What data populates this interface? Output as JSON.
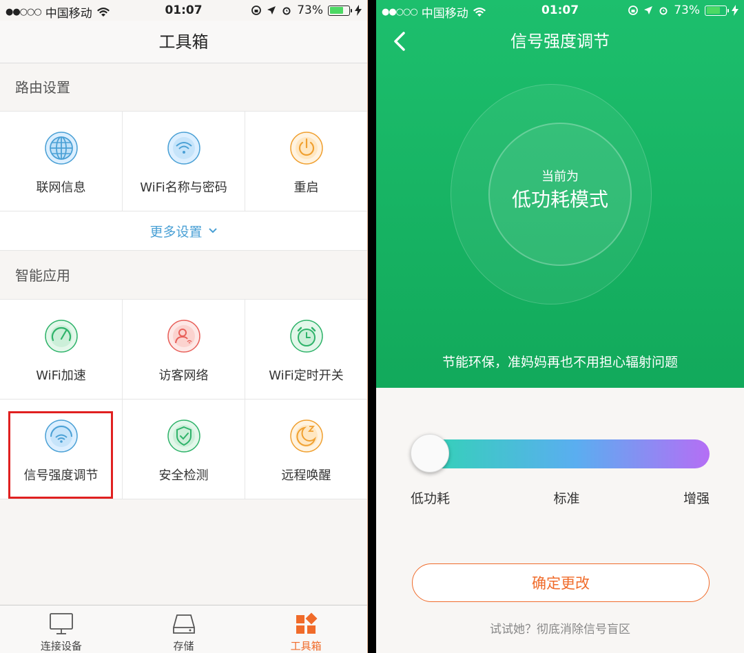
{
  "left": {
    "status": {
      "signal_dots": "●●○○○",
      "carrier": "中国移动",
      "time": "01:07",
      "battery": "73%",
      "battery_level": 0.73
    },
    "title": "工具箱",
    "section_router": {
      "heading": "路由设置",
      "items": [
        {
          "label": "联网信息",
          "icon": "globe-icon",
          "color": "#4aa0d5"
        },
        {
          "label": "WiFi名称与密码",
          "icon": "wifi-icon",
          "color": "#4aa0d5"
        },
        {
          "label": "重启",
          "icon": "power-icon",
          "color": "#f0a030"
        }
      ],
      "more_label": "更多设置"
    },
    "section_apps": {
      "heading": "智能应用",
      "items": [
        {
          "label": "WiFi加速",
          "icon": "speedometer-icon",
          "color": "#2fb36a"
        },
        {
          "label": "访客网络",
          "icon": "guest-user-icon",
          "color": "#e8605a"
        },
        {
          "label": "WiFi定时开关",
          "icon": "alarm-clock-icon",
          "color": "#2fb36a"
        },
        {
          "label": "信号强度调节",
          "icon": "signal-strength-icon",
          "color": "#4aa0d5"
        },
        {
          "label": "安全检测",
          "icon": "shield-check-icon",
          "color": "#2fb36a"
        },
        {
          "label": "远程唤醒",
          "icon": "moon-sleep-icon",
          "color": "#f0a030"
        }
      ]
    },
    "tabs": [
      {
        "label": "连接设备",
        "icon": "monitor-icon"
      },
      {
        "label": "存储",
        "icon": "hard-drive-icon"
      },
      {
        "label": "工具箱",
        "icon": "toolbox-icon",
        "active": true
      }
    ],
    "accent": "#f06b2a"
  },
  "right": {
    "status": {
      "signal_dots": "●●○○○",
      "carrier": "中国移动",
      "time": "01:07",
      "battery": "73%",
      "battery_level": 0.73
    },
    "title": "信号强度调节",
    "mode_caption": "当前为",
    "mode_value": "低功耗模式",
    "tagline": "节能环保，准妈妈再也不用担心辐射问题",
    "slider": {
      "labels": [
        "低功耗",
        "标准",
        "增强"
      ],
      "selected_index": 0,
      "value": 0
    },
    "confirm_label": "确定更改",
    "hint": "试试她？彻底消除信号盲区",
    "hero_color": "#17b464"
  }
}
